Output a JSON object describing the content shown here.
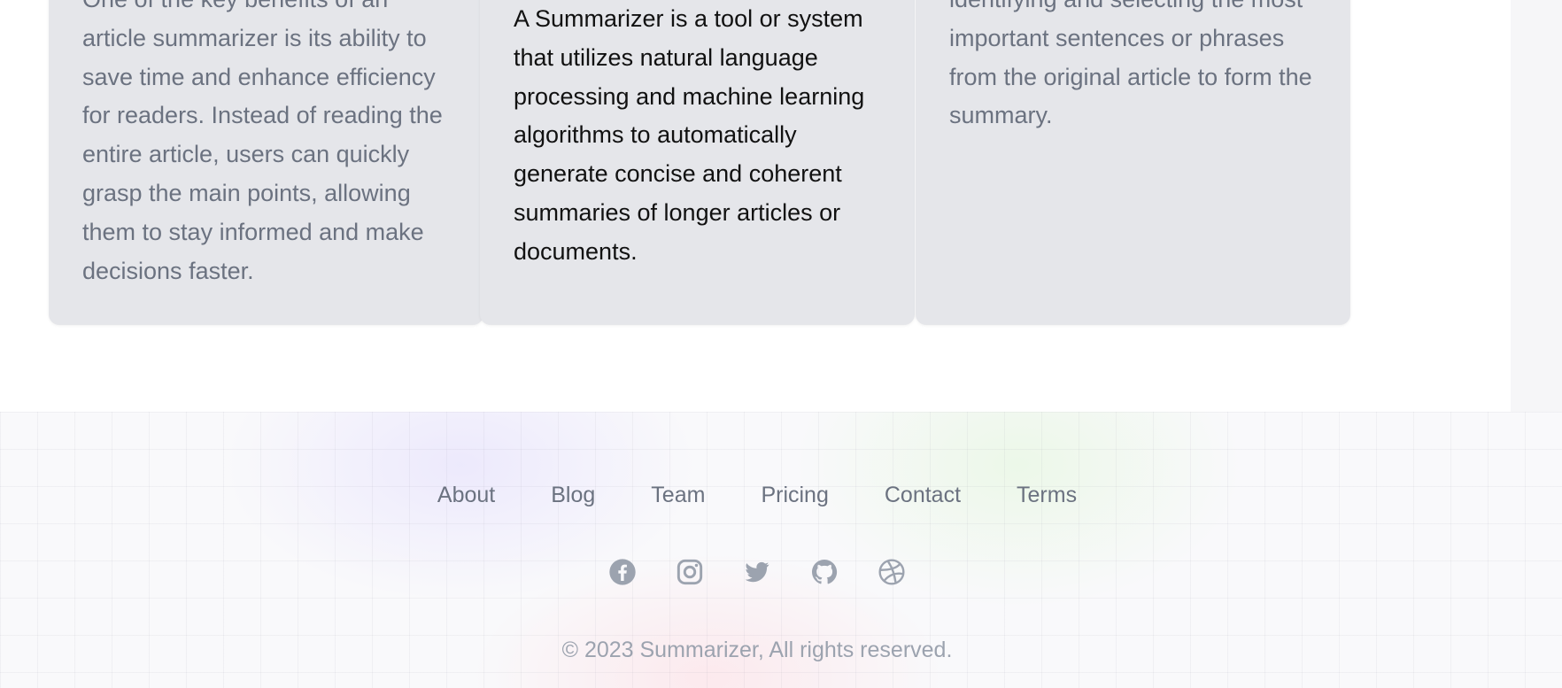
{
  "cards": [
    {
      "text": "One of the key benefits of an article summarizer is its ability to save time and enhance efficiency for readers. Instead of reading the entire article, users can quickly grasp the main points, allowing them to stay informed and make decisions faster."
    },
    {
      "text": "A Summarizer is a tool or system that utilizes natural language processing and machine learning algorithms to automatically generate concise and coherent summaries of longer articles or documents."
    },
    {
      "text": "identifying and selecting the most important sentences or phrases from the original article to form the summary."
    }
  ],
  "footer": {
    "nav": [
      "About",
      "Blog",
      "Team",
      "Pricing",
      "Contact",
      "Terms"
    ],
    "socials": [
      "facebook-icon",
      "instagram-icon",
      "twitter-icon",
      "github-icon",
      "dribbble-icon"
    ],
    "copyright": "© 2023 Summarizer, All rights reserved."
  },
  "colors": {
    "card_bg": "#e5e6ea",
    "muted_text": "#6b7280",
    "dark_text": "#111111",
    "icon": "#9ca3af"
  }
}
